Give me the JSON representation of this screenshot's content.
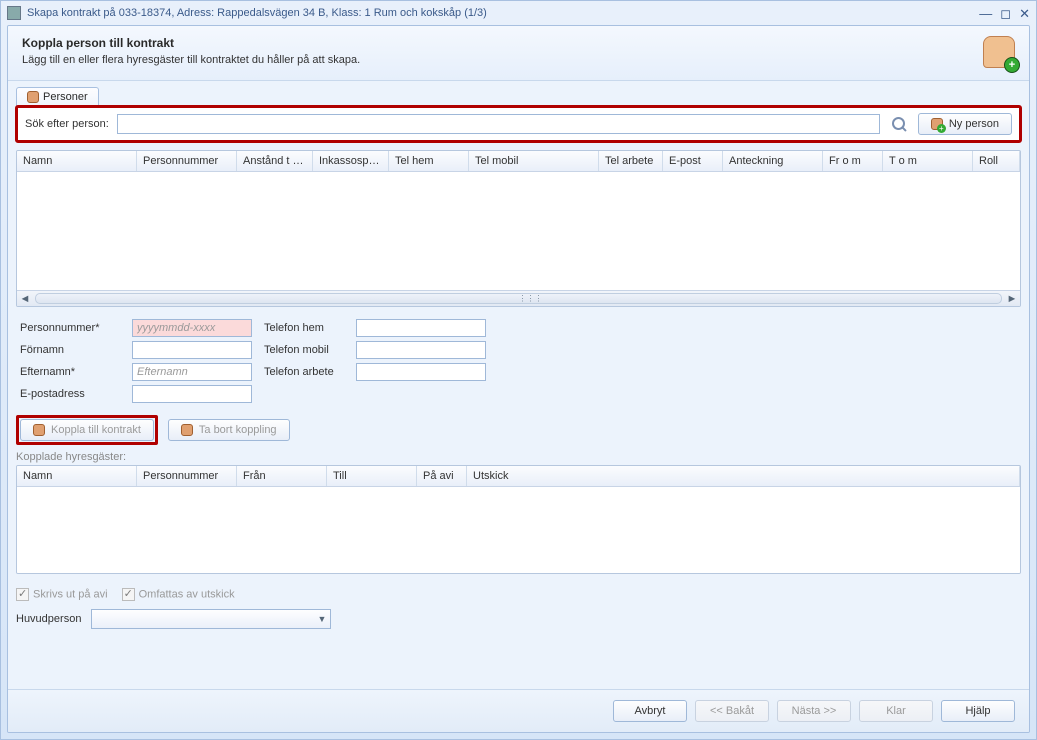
{
  "window": {
    "title": "Skapa kontrakt på 033-18374, Adress: Rappedalsvägen 34 B, Klass: 1 Rum och kokskåp (1/3)"
  },
  "header": {
    "title": "Koppla person till kontrakt",
    "subtitle": "Lägg till en eller flera hyresgäster till kontraktet du håller på att skapa."
  },
  "tabs": {
    "personer": "Personer"
  },
  "search": {
    "label": "Sök efter person:",
    "value": "",
    "new_person": "Ny person"
  },
  "grid1": {
    "cols": [
      "Namn",
      "Personnummer",
      "Anstånd t o...",
      "Inkassospä...",
      "Tel hem",
      "Tel mobil",
      "Tel arbete",
      "E-post",
      "Anteckning",
      "Fr o m",
      "T o m",
      "Roll"
    ]
  },
  "form": {
    "personnummer_label": "Personnummer*",
    "personnummer_placeholder": "yyyymmdd-xxxx",
    "fornamn_label": "Förnamn",
    "efternamn_label": "Efternamn*",
    "efternamn_placeholder": "Efternamn",
    "epost_label": "E-postadress",
    "tel_hem_label": "Telefon hem",
    "tel_mobil_label": "Telefon mobil",
    "tel_arbete_label": "Telefon arbete"
  },
  "actions": {
    "koppla": "Koppla till kontrakt",
    "tabort": "Ta bort koppling"
  },
  "section2_label": "Kopplade hyresgäster:",
  "grid2": {
    "cols": [
      "Namn",
      "Personnummer",
      "Från",
      "Till",
      "På avi",
      "Utskick"
    ]
  },
  "checks": {
    "skrivs": "Skrivs ut på avi",
    "omfattas": "Omfattas av utskick"
  },
  "huvudperson_label": "Huvudperson",
  "footer": {
    "avbryt": "Avbryt",
    "bakat": "<< Bakåt",
    "nasta": "Nästa >>",
    "klar": "Klar",
    "hjalp": "Hjälp"
  }
}
